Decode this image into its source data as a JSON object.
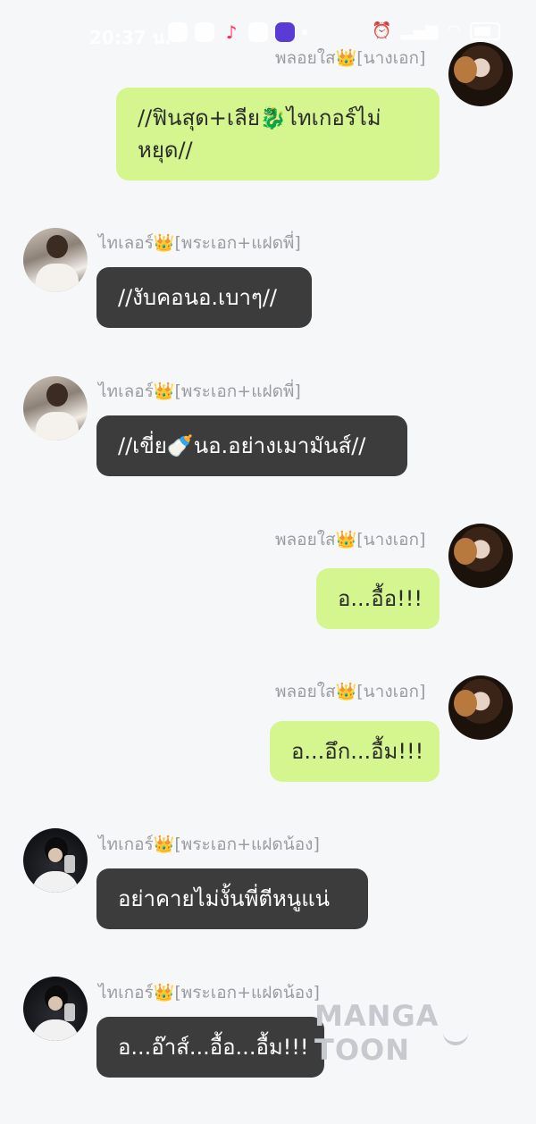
{
  "status_bar": {
    "time": "20:37 น.",
    "icons": [
      "gallery-icon",
      "snapchat-icon",
      "tiktok-icon",
      "youtube-icon",
      "discord-icon",
      "alarm-icon",
      "signal-icon",
      "wifi-icon",
      "battery-icon"
    ],
    "battery": "87"
  },
  "crown": "👑",
  "messages": [
    {
      "sender": "พลอยใส",
      "role": "[นางเอก]",
      "side": "right",
      "text": "//ฟินสุด+เลีย🐉ไทเกอร์ไม่หยุด//"
    },
    {
      "sender": "ไทเลอร์",
      "role": "[พระเอก+แฝดพี่]",
      "side": "left",
      "text": "//งับคอนอ.เบาๆ//"
    },
    {
      "sender": "ไทเลอร์",
      "role": "[พระเอก+แฝดพี่]",
      "side": "left",
      "text": "//เขี่ย🍼นอ.อย่างเมามันส์//"
    },
    {
      "sender": "พลอยใส",
      "role": "[นางเอก]",
      "side": "right",
      "text": "อ...อื้อ!!!"
    },
    {
      "sender": "พลอยใส",
      "role": "[นางเอก]",
      "side": "right",
      "text": "อ...อึก...อื้ม!!!"
    },
    {
      "sender": "ไทเกอร์",
      "role": "[พระเอก+แฝดน้อง]",
      "side": "left",
      "text": "อย่าคายไม่งั้นพี่ตีหนูแน่"
    },
    {
      "sender": "ไทเกอร์",
      "role": "[พระเอก+แฝดน้อง]",
      "side": "left",
      "text": "อ...อ๊าส์...อื้อ...อื้ม!!!"
    }
  ],
  "watermark": "MANGA TOON",
  "colors": {
    "background": "#f6f7f9",
    "right_bubble": "#d5f58e",
    "left_bubble": "#3c3c3c",
    "name_text": "#9a9ca0"
  }
}
